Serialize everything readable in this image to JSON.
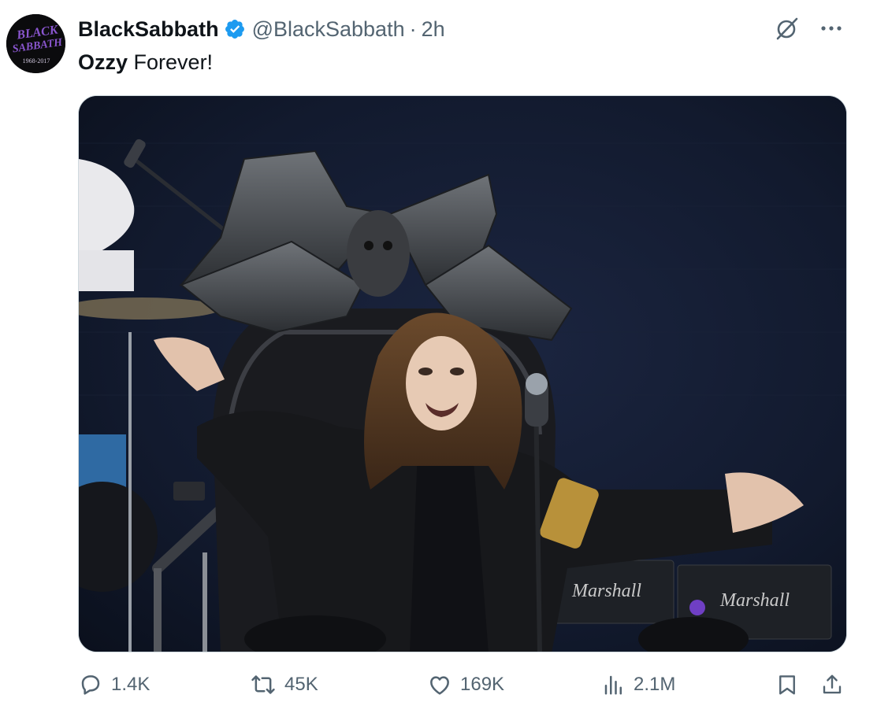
{
  "author": {
    "display_name": "BlackSabbath",
    "handle": "@BlackSabbath",
    "separator": "·",
    "time": "2h",
    "verified": true,
    "avatar": {
      "logo_line1": "BLACK",
      "logo_line2": "SABBATH",
      "years": "1968-2017"
    }
  },
  "post": {
    "text_bold": "Ozzy",
    "text_rest": " Forever!"
  },
  "header_icons": [
    "grok-icon",
    "more-icon"
  ],
  "metrics": {
    "replies": "1.4K",
    "reposts": "45K",
    "likes": "169K",
    "views": "2.1M"
  },
  "colors": {
    "text": "#0f1419",
    "secondary": "#536471",
    "verified": "#1d9bf0",
    "avatar_purple": "#7a4cc2"
  }
}
